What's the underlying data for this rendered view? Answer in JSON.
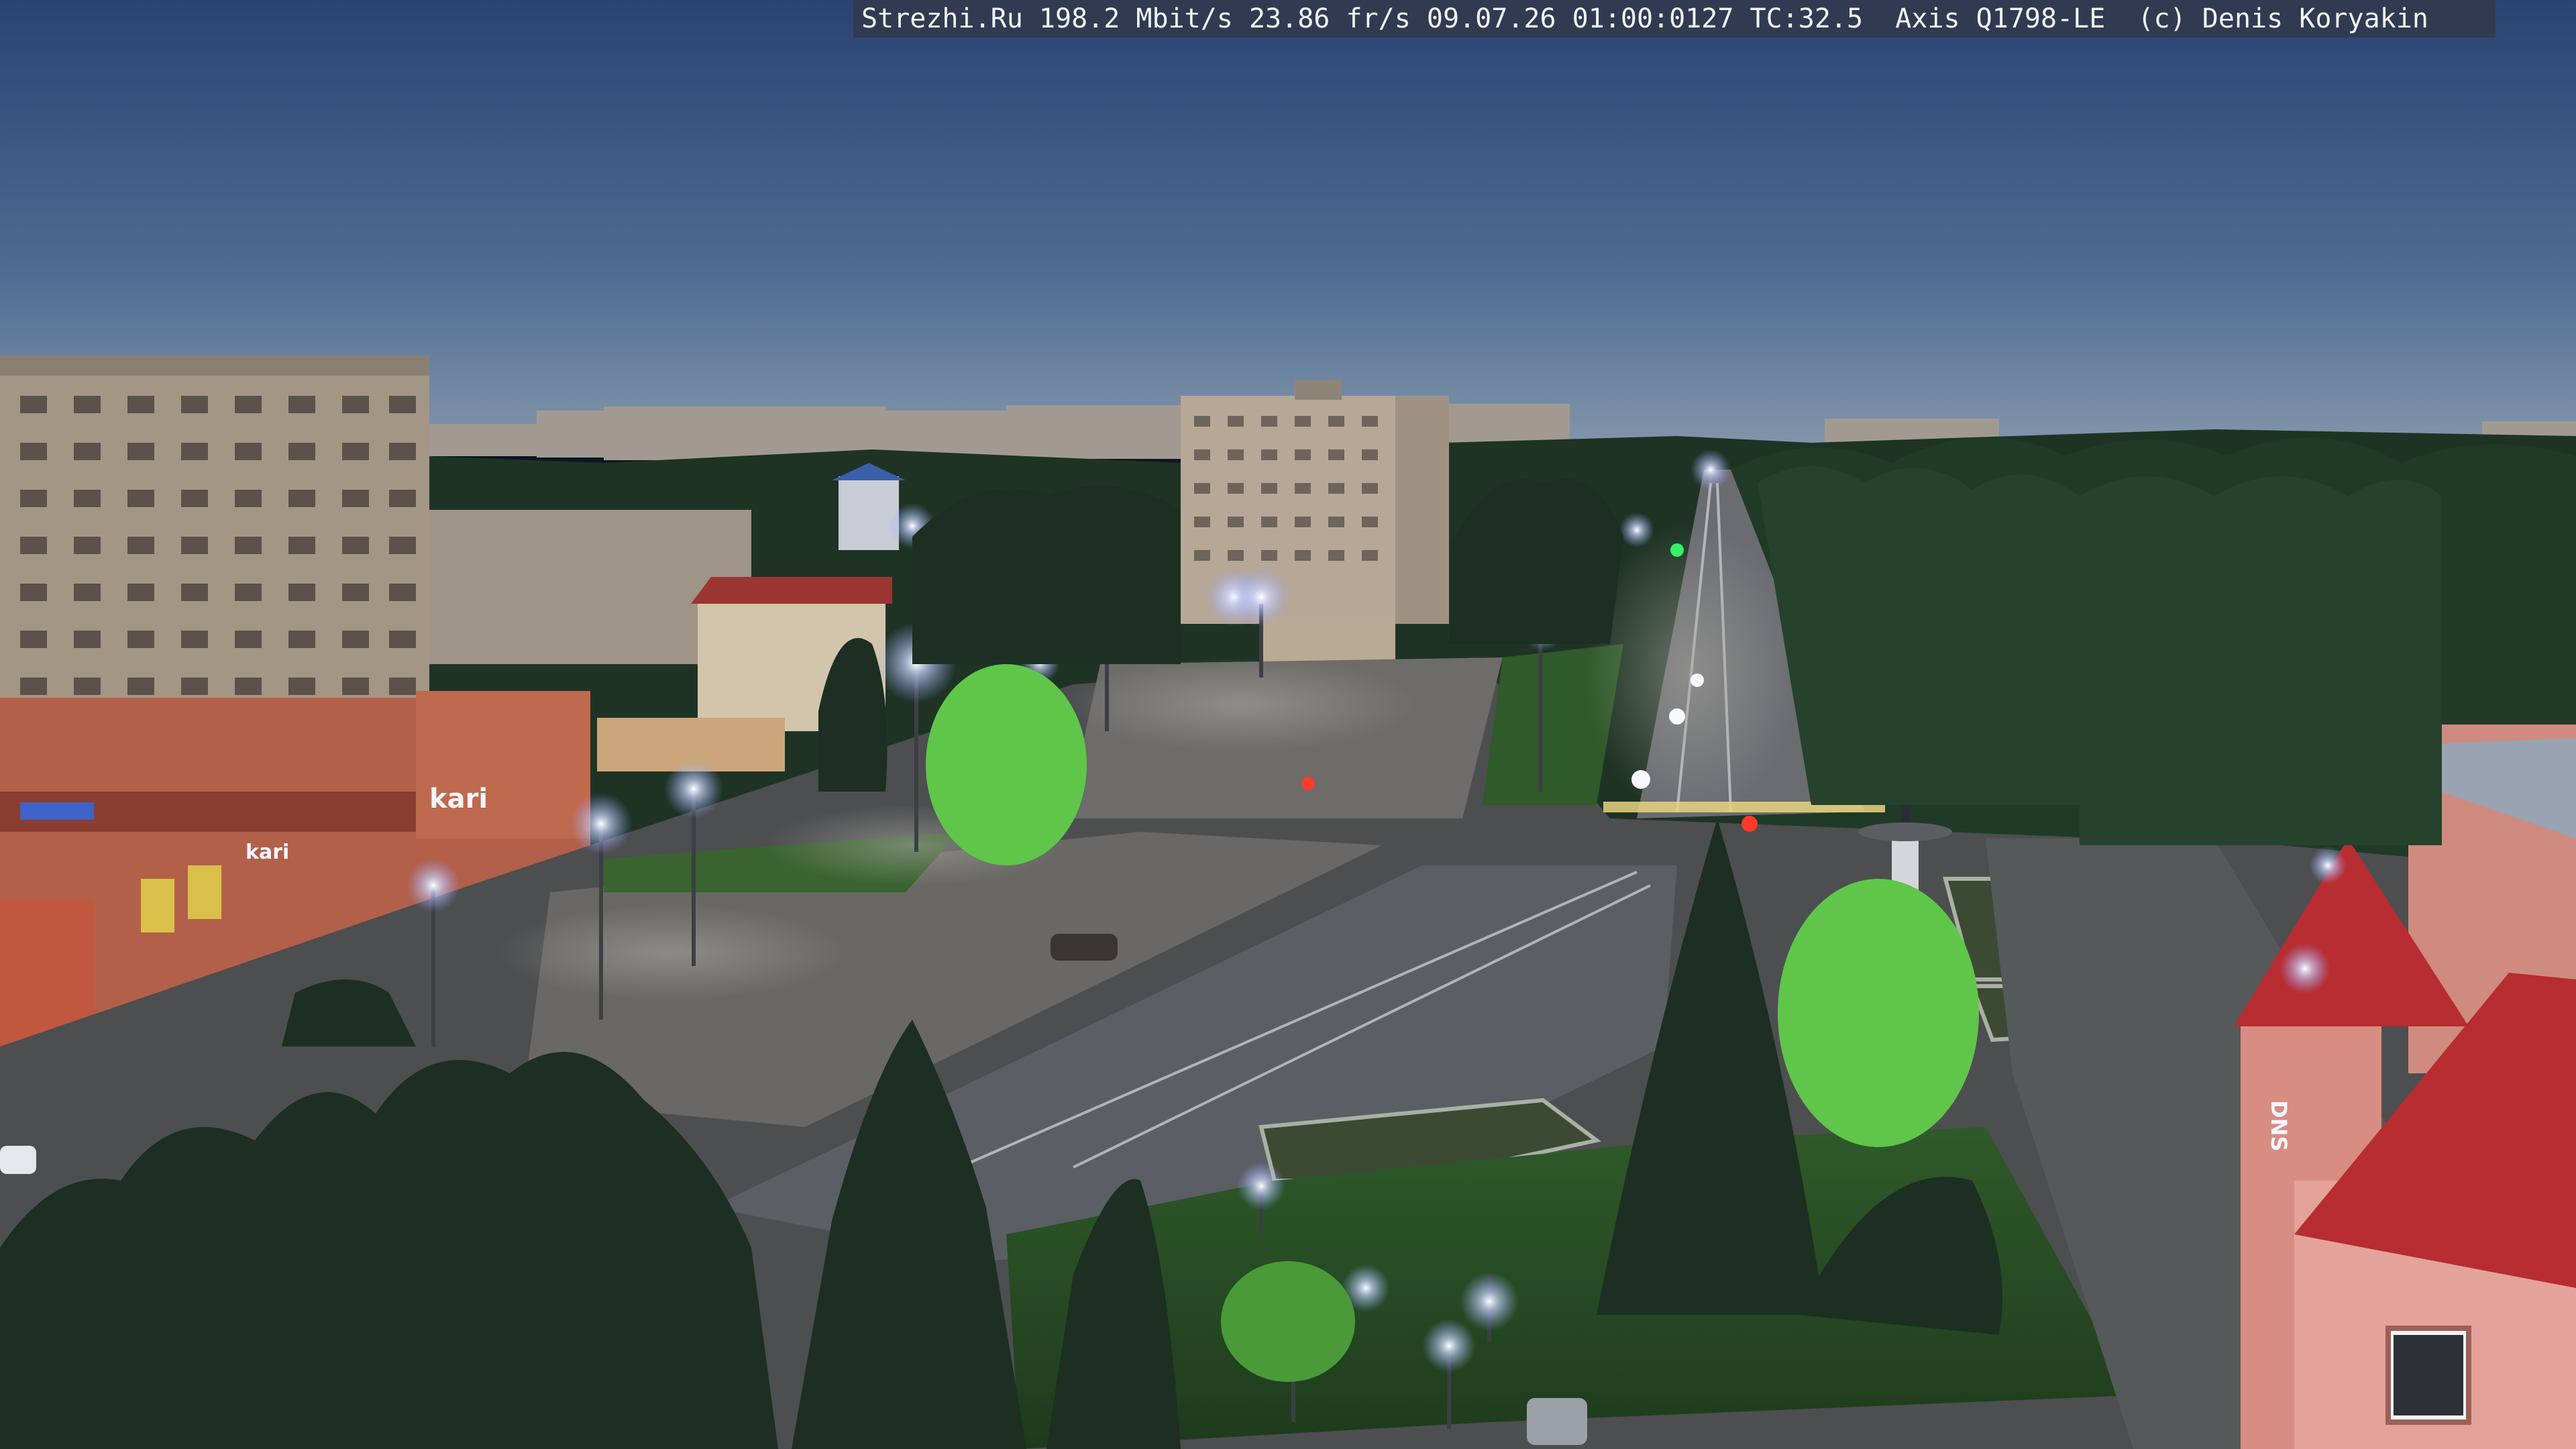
{
  "overlay": {
    "text": "Strezhi.Ru 198.2 Mbit/s 23.86 fr/s 09.07.26 01:00:0127 TC:32.5  Axis Q1798-LE  (c) Denis Koryakin"
  },
  "signs": {
    "kari_main": "kari",
    "kari_small": "kari",
    "dns_vertical": "DNS"
  },
  "colors": {
    "sky_top": "#2f4a78",
    "sky_bottom": "#7f95ac",
    "road": "#5b5e64",
    "lamp": "#dfe6ff",
    "brick": "#b2604a",
    "roof_red": "#b72d31",
    "tree_dark": "#1c2f22",
    "tree_lit": "#5fc64a"
  }
}
